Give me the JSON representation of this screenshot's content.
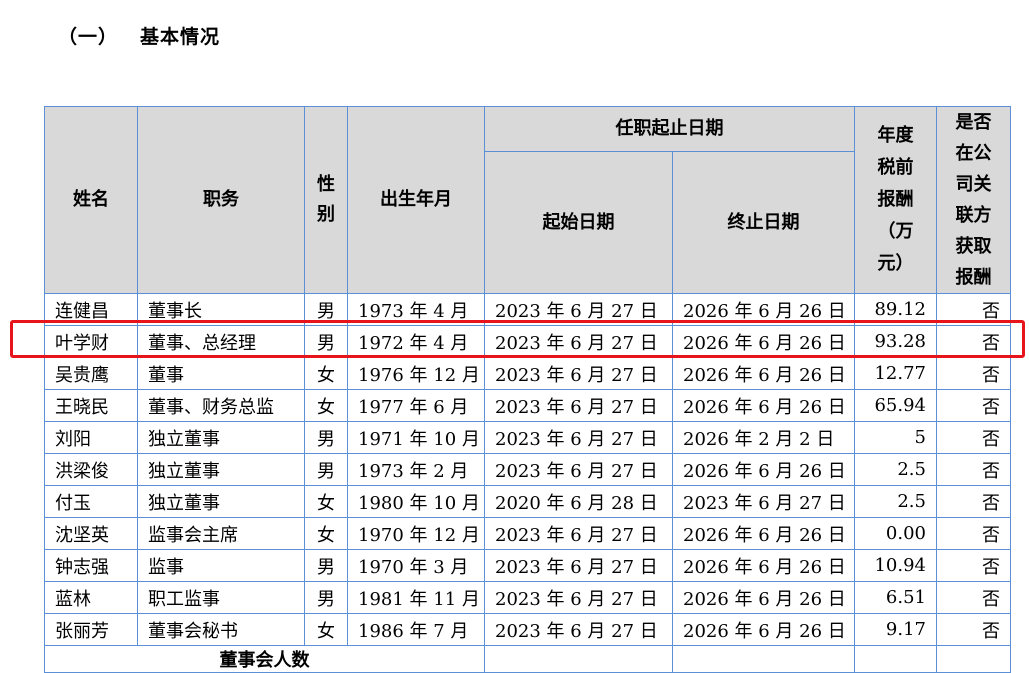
{
  "section": {
    "number": "（一）",
    "title": "基本情况"
  },
  "table": {
    "headers": {
      "name": "姓名",
      "position": "职务",
      "gender": "性别",
      "birth": "出生年月",
      "term": "任职起止日期",
      "start": "起始日期",
      "end": "终止日期",
      "salary": "年度税前报酬（万元）",
      "related": "是否在公司关联方获取报酬"
    },
    "rows": [
      {
        "name": "连健昌",
        "position": "董事长",
        "gender": "男",
        "birth": "1973 年 4 月",
        "start": "2023 年 6 月 27 日",
        "end": "2026 年 6 月 26 日",
        "salary": "89.12",
        "related": "否"
      },
      {
        "name": "叶学财",
        "position": "董事、总经理",
        "gender": "男",
        "birth": "1972 年 4 月",
        "start": "2023 年 6 月 27 日",
        "end": "2026 年 6 月 26 日",
        "salary": "93.28",
        "related": "否"
      },
      {
        "name": "吴贵鹰",
        "position": "董事",
        "gender": "女",
        "birth": "1976 年 12 月",
        "start": "2023 年 6 月 27 日",
        "end": "2026 年 6 月 26 日",
        "salary": "12.77",
        "related": "否"
      },
      {
        "name": "王晓民",
        "position": "董事、财务总监",
        "gender": "女",
        "birth": "1977 年 6 月",
        "start": "2023 年 6 月 27 日",
        "end": "2026 年 6 月 26 日",
        "salary": "65.94",
        "related": "否"
      },
      {
        "name": "刘阳",
        "position": "独立董事",
        "gender": "男",
        "birth": "1971 年 10 月",
        "start": "2023 年 6 月 27 日",
        "end": "2026 年 2 月 2 日",
        "salary": "5",
        "related": "否"
      },
      {
        "name": "洪梁俊",
        "position": "独立董事",
        "gender": "男",
        "birth": "1973 年 2 月",
        "start": "2023 年 6 月 27 日",
        "end": "2026 年 6 月 26 日",
        "salary": "2.5",
        "related": "否"
      },
      {
        "name": "付玉",
        "position": "独立董事",
        "gender": "女",
        "birth": "1980 年 10 月",
        "start": "2020 年 6 月 28 日",
        "end": "2023 年 6 月 27 日",
        "salary": "2.5",
        "related": "否"
      },
      {
        "name": "沈坚英",
        "position": "监事会主席",
        "gender": "女",
        "birth": "1970 年 12 月",
        "start": "2023 年 6 月 27 日",
        "end": "2026 年 6 月 26 日",
        "salary": "0.00",
        "related": "否"
      },
      {
        "name": "钟志强",
        "position": "监事",
        "gender": "男",
        "birth": "1970 年 3 月",
        "start": "2023 年 6 月 27 日",
        "end": "2026 年 6 月 26 日",
        "salary": "10.94",
        "related": "否"
      },
      {
        "name": "蓝林",
        "position": "职工监事",
        "gender": "男",
        "birth": "1981 年 11 月",
        "start": "2023 年 6 月 27 日",
        "end": "2026 年 6 月 26 日",
        "salary": "6.51",
        "related": "否"
      },
      {
        "name": "张丽芳",
        "position": "董事会秘书",
        "gender": "女",
        "birth": "1986 年 7 月",
        "start": "2023 年 6 月 27 日",
        "end": "2026 年 6 月 26 日",
        "salary": "9.17",
        "related": "否"
      }
    ],
    "footer_label": "董事会人数"
  },
  "colors": {
    "border": "#5b8fd6",
    "header_bg": "#d9d9d9",
    "highlight": "#e8141c"
  }
}
